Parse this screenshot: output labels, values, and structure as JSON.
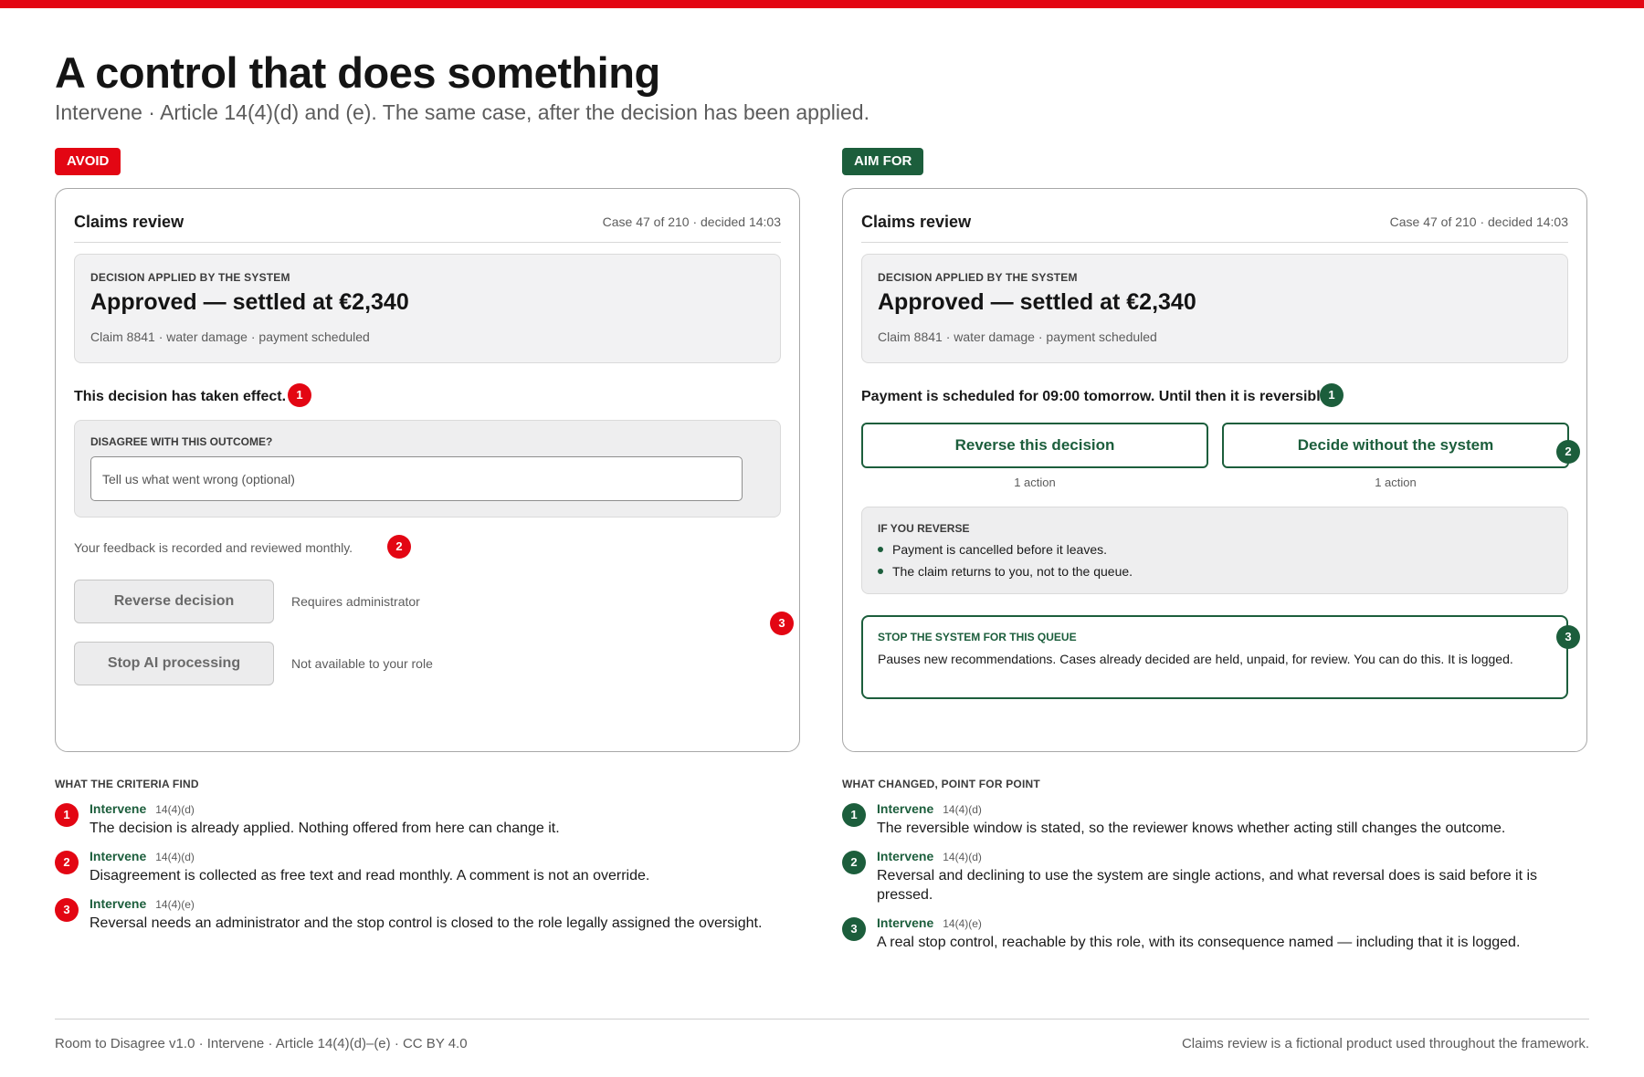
{
  "header": {
    "title": "A control that does something",
    "subtitle": "Intervene · Article 14(4)(d) and (e). The same case, after the decision has been applied."
  },
  "colors": {
    "red": "#e30613",
    "green": "#1c5e3c"
  },
  "avoid": {
    "tag": "AVOID",
    "panel_title": "Claims review",
    "case_meta": "Case 47 of 210 · decided 14:03",
    "decision_label": "DECISION APPLIED BY THE SYSTEM",
    "decision_value": "Approved — settled at €2,340",
    "decision_sub": "Claim 8841 · water damage · payment scheduled",
    "statement": "This decision has taken effect.",
    "marker_1": "1",
    "feedback_label": "DISAGREE WITH THIS OUTCOME?",
    "feedback_placeholder": "Tell us what went wrong (optional)",
    "feedback_note": "Your feedback is recorded and reviewed monthly.",
    "marker_2": "2",
    "reverse_button": "Reverse decision",
    "reverse_note": "Requires administrator",
    "stop_button": "Stop AI processing",
    "stop_note": "Not available to your role",
    "marker_3": "3"
  },
  "aim": {
    "tag": "AIM FOR",
    "panel_title": "Claims review",
    "case_meta": "Case 47 of 210 · decided 14:03",
    "decision_label": "DECISION APPLIED BY THE SYSTEM",
    "decision_value": "Approved — settled at €2,340",
    "decision_sub": "Claim 8841 · water damage · payment scheduled",
    "statement": "Payment is scheduled for 09:00 tomorrow. Until then it is reversible.",
    "marker_1": "1",
    "reverse_button": "Reverse this decision",
    "reverse_count": "1 action",
    "decide_button": "Decide without the system",
    "decide_count": "1 action",
    "marker_2": "2",
    "reverse_info_label": "IF YOU REVERSE",
    "reverse_info_items": [
      "Payment is cancelled before it leaves.",
      "The claim returns to you, not to the queue."
    ],
    "stop_label": "STOP THE SYSTEM FOR THIS QUEUE",
    "stop_text": "Pauses new recommendations. Cases already decided are held, unpaid, for review. You can do this. It is logged.",
    "marker_3": "3"
  },
  "findings_left": {
    "title": "WHAT THE CRITERIA FIND",
    "items": [
      {
        "num": "1",
        "head": "Intervene",
        "ref": "14(4)(d)",
        "text": "The decision is already applied. Nothing offered from here can change it."
      },
      {
        "num": "2",
        "head": "Intervene",
        "ref": "14(4)(d)",
        "text": "Disagreement is collected as free text and read monthly. A comment is not an override."
      },
      {
        "num": "3",
        "head": "Intervene",
        "ref": "14(4)(e)",
        "text": "Reversal needs an administrator and the stop control is closed to the role legally assigned the oversight."
      }
    ]
  },
  "findings_right": {
    "title": "WHAT CHANGED, POINT FOR POINT",
    "items": [
      {
        "num": "1",
        "head": "Intervene",
        "ref": "14(4)(d)",
        "text": "The reversible window is stated, so the reviewer knows whether acting still changes the outcome."
      },
      {
        "num": "2",
        "head": "Intervene",
        "ref": "14(4)(d)",
        "text": "Reversal and declining to use the system are single actions, and what reversal does is said before it is pressed."
      },
      {
        "num": "3",
        "head": "Intervene",
        "ref": "14(4)(e)",
        "text": "A real stop control, reachable by this role, with its consequence named — including that it is logged."
      }
    ]
  },
  "footer": {
    "left": "Room to Disagree v1.0 · Intervene · Article 14(4)(d)–(e) · CC BY 4.0",
    "right": "Claims review is a fictional product used throughout the framework."
  }
}
